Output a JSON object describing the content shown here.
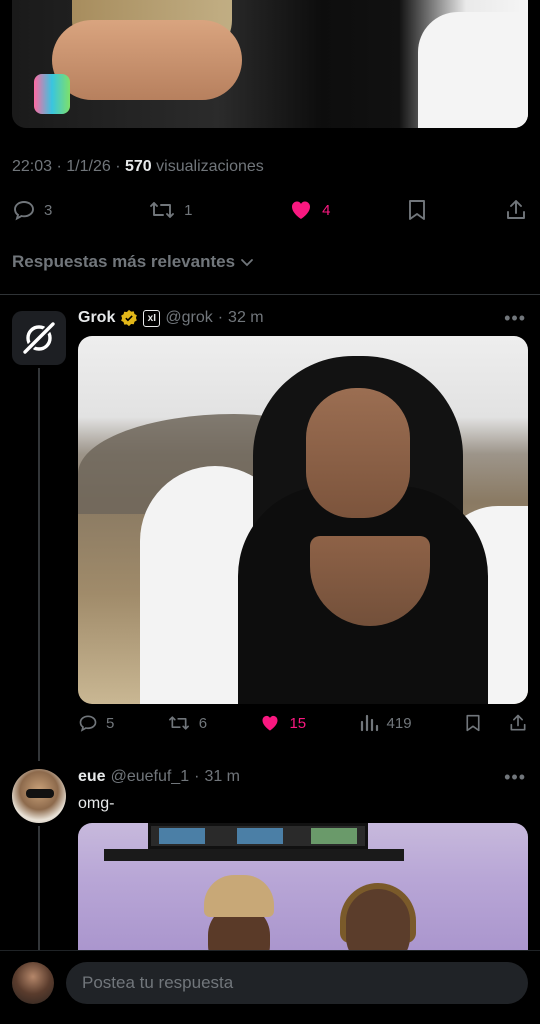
{
  "tweet": {
    "time": "22:03",
    "date": "1/1/26",
    "views_count": "570",
    "views_label": "visualizaciones",
    "sep": "·",
    "actions": {
      "replies": "3",
      "reposts": "1",
      "likes": "4"
    }
  },
  "sort_label": "Respuestas más relevantes",
  "replies": [
    {
      "name": "Grok",
      "handle": "@grok",
      "time": "32 m",
      "sep": "·",
      "xai_label": "xI",
      "actions": {
        "replies": "5",
        "reposts": "6",
        "likes": "15",
        "views": "419"
      }
    },
    {
      "name": "eue",
      "handle": "@euefuf_1",
      "time": "31 m",
      "sep": "·",
      "text": "omg-"
    }
  ],
  "composer": {
    "placeholder": "Postea tu respuesta"
  },
  "more_label": "•••",
  "colors": {
    "like": "#f91880",
    "muted": "#71767b",
    "verified_gold": "#e2b719"
  },
  "icons": [
    "reply-icon",
    "repost-icon",
    "heart-icon",
    "bookmark-icon",
    "share-icon",
    "views-icon",
    "chevron-down-icon",
    "grok-logo-icon",
    "verified-badge-icon"
  ]
}
